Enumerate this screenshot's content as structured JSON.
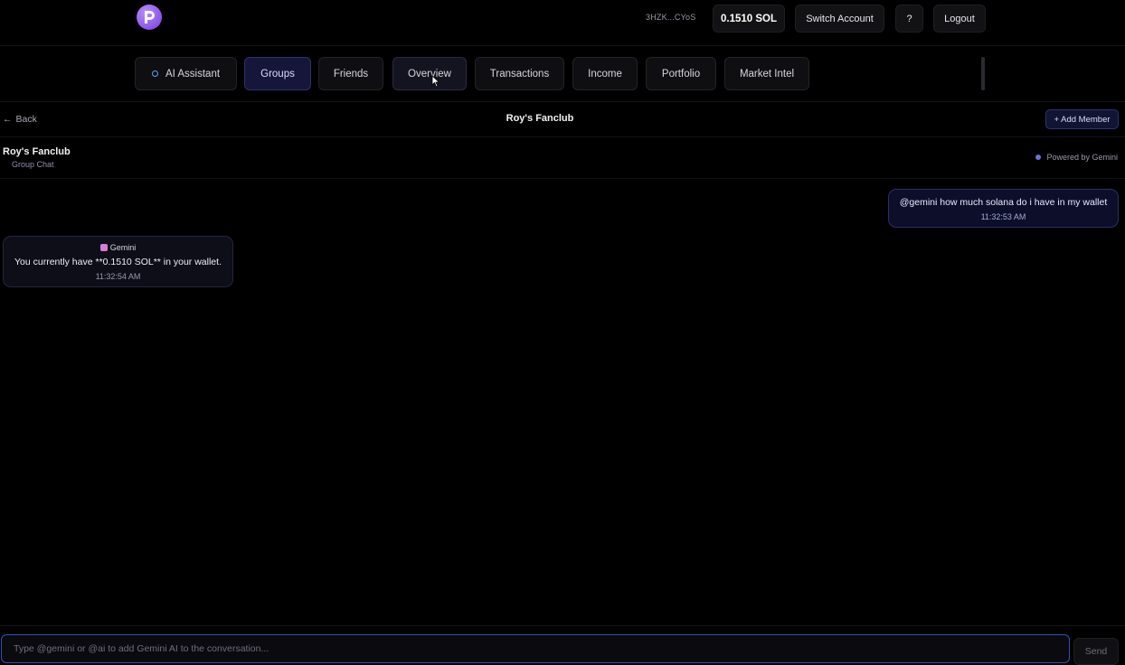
{
  "topbar": {
    "wallet_address": "3HZK...CYoS",
    "sol_balance": "0.1510 SOL",
    "switch_account_label": "Switch Account",
    "help_label": "?",
    "logout_label": "Logout"
  },
  "nav": {
    "tabs": [
      {
        "label": "AI Assistant"
      },
      {
        "label": "Groups"
      },
      {
        "label": "Friends"
      },
      {
        "label": "Overview"
      },
      {
        "label": "Transactions"
      },
      {
        "label": "Income"
      },
      {
        "label": "Portfolio"
      },
      {
        "label": "Market Intel"
      }
    ],
    "active_tab": "Groups"
  },
  "header": {
    "back_label": "Back",
    "back_arrow": "←",
    "title": "Roy's Fanclub",
    "add_member_label": "+ Add Member"
  },
  "group_info": {
    "name": "Roy's Fanclub",
    "type": "Group Chat",
    "powered_by": "Powered by Gemini"
  },
  "messages": [
    {
      "sender": "user",
      "text": "@gemini how much solana do i have in my wallet",
      "time": "11:32:53 AM"
    },
    {
      "sender": "Gemini",
      "text": "You currently have **0.1510 SOL** in your wallet.",
      "time": "11:32:54 AM"
    }
  ],
  "composer": {
    "placeholder": "Type @gemini or @ai to add Gemini AI to the conversation...",
    "value": "",
    "send_label": "Send"
  },
  "colors": {
    "background": "#000000",
    "accent": "#2e3170",
    "logo": "#8b4ff0",
    "input_border": "#3a4fb0"
  }
}
